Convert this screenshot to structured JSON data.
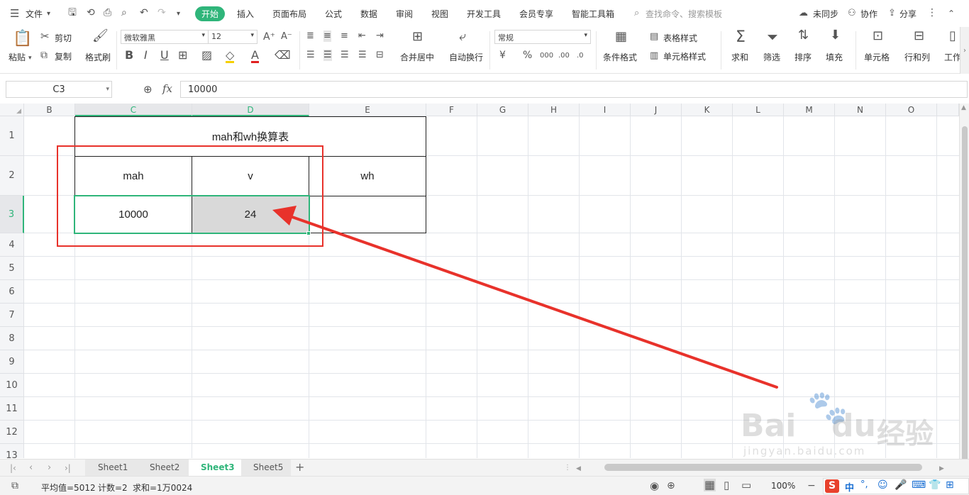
{
  "menubar": {
    "file_label": "文件",
    "tabs": [
      "开始",
      "插入",
      "页面布局",
      "公式",
      "数据",
      "审阅",
      "视图",
      "开发工具",
      "会员专享",
      "智能工具箱"
    ],
    "search_placeholder": "查找命令、搜索模板",
    "sync_label": "未同步",
    "collab_label": "协作",
    "share_label": "分享"
  },
  "ribbon": {
    "paste": "粘贴",
    "cut": "剪切",
    "copy": "复制",
    "format_painter": "格式刷",
    "font_name": "微软雅黑",
    "font_size": "12",
    "merge_center": "合并居中",
    "wrap_text": "自动换行",
    "number_format": "常规",
    "cond_format": "条件格式",
    "table_style": "表格样式",
    "cell_style": "单元格样式",
    "sum": "求和",
    "filter": "筛选",
    "sort": "排序",
    "fill": "填充",
    "cell": "单元格",
    "rowcol": "行和列",
    "worksheet": "工作"
  },
  "formula_bar": {
    "name_box": "C3",
    "fx": "fx",
    "value": "10000"
  },
  "grid": {
    "columns": [
      "B",
      "C",
      "D",
      "E",
      "F",
      "G",
      "H",
      "I",
      "J",
      "K",
      "L",
      "M",
      "N",
      "O"
    ],
    "rows": [
      "1",
      "2",
      "3",
      "4",
      "5",
      "6",
      "7",
      "8",
      "9",
      "10",
      "11",
      "12",
      "13"
    ],
    "title": "mah和wh换算表",
    "header_mah": "mah",
    "header_v": "v",
    "header_wh": "wh",
    "val_mah": "10000",
    "val_v": "24"
  },
  "sheets": [
    "Sheet1",
    "Sheet2",
    "Sheet3",
    "Sheet5"
  ],
  "active_sheet": "Sheet3",
  "status": {
    "average": "平均值=5012",
    "count": "计数=2",
    "sum": "求和=1万0024",
    "zoom": "100%"
  },
  "watermark": {
    "brand": "Bai",
    "brand2": "du",
    "brand_cn": "经验",
    "url": "jingyan.baidu.com"
  },
  "colors": {
    "accent": "#2fb57a",
    "annotation_red": "#e8322b",
    "selected_fill": "#d9d9d9"
  }
}
